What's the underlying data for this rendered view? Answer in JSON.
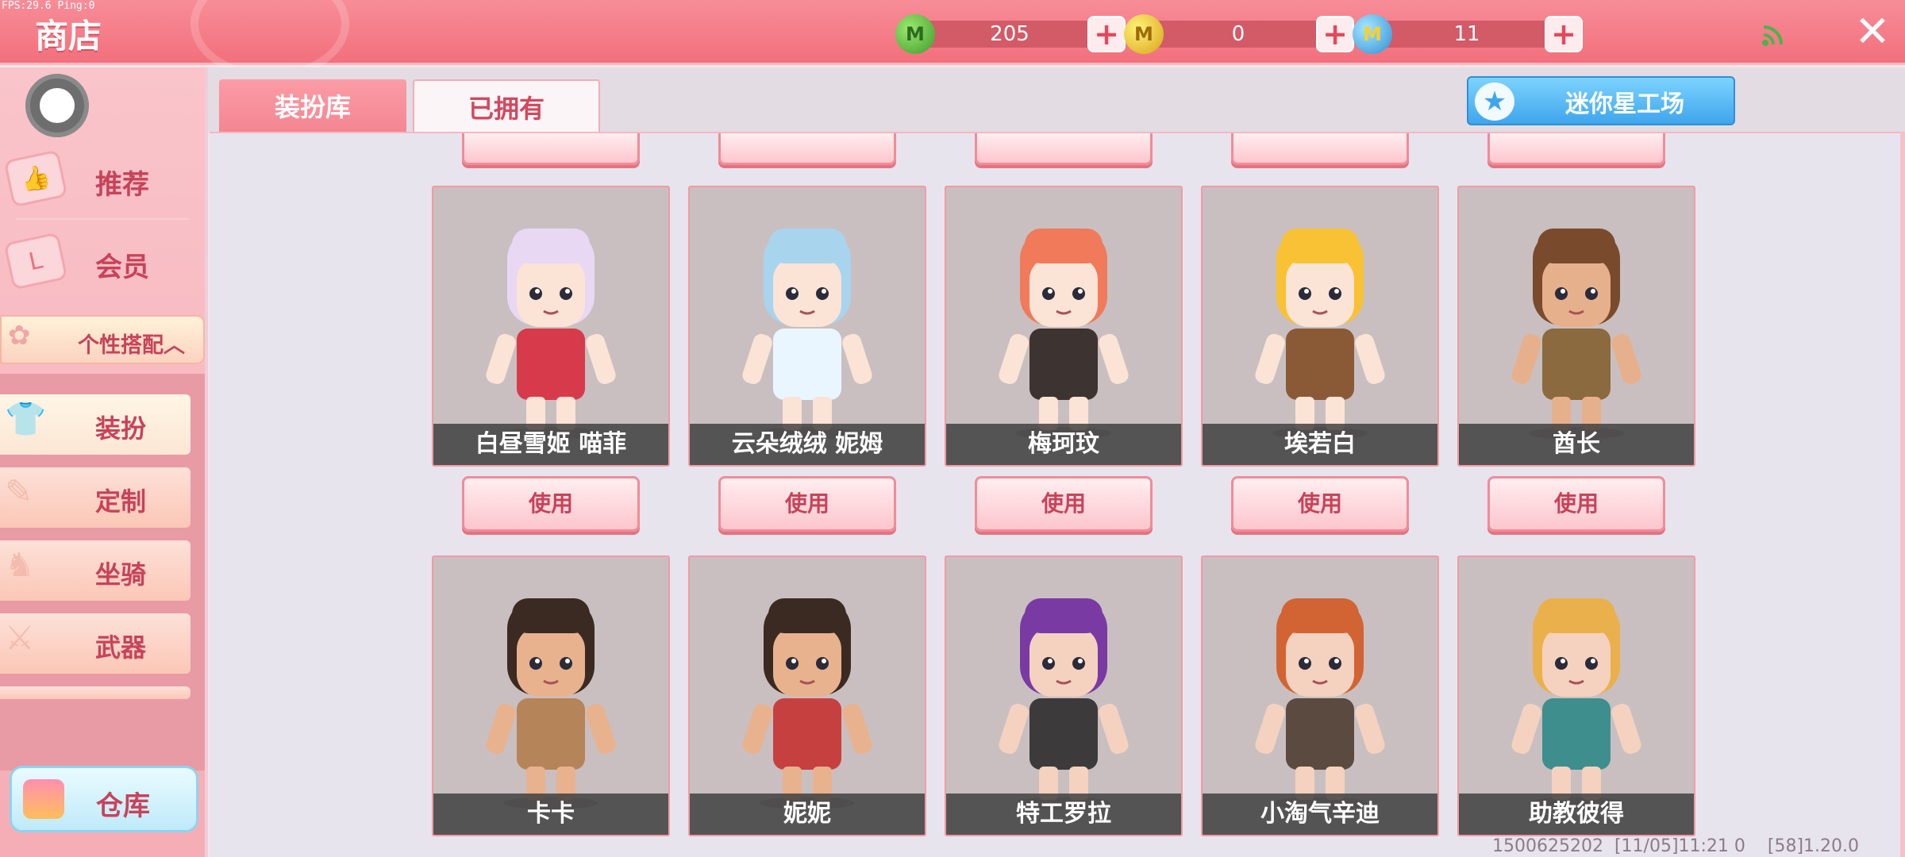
{
  "topbar": {
    "fps": "FPS:29.6  Ping:0",
    "title": "商店",
    "currencies": [
      {
        "name": "green-gem",
        "value": "205",
        "color": "#3f9a2b"
      },
      {
        "name": "gold-coin",
        "value": "0",
        "color": "#d8a317"
      },
      {
        "name": "blue-star-coin",
        "value": "11",
        "color": "#2f8fd6"
      }
    ],
    "signal_icon": "wifi-signal-icon",
    "close_icon": "close-icon"
  },
  "sidebar": {
    "main_items": [
      {
        "label": "推荐",
        "icon": "thumbs-up-icon"
      },
      {
        "label": "会员",
        "icon": "vip-card-icon"
      }
    ],
    "group": {
      "label": "个性搭配︿",
      "icon": "flower-icon"
    },
    "sub_items": [
      {
        "label": "装扮",
        "icon": "shirt-icon",
        "active": true
      },
      {
        "label": "定制",
        "icon": "pencil-icon",
        "active": false
      },
      {
        "label": "坐骑",
        "icon": "mount-icon",
        "active": false
      },
      {
        "label": "武器",
        "icon": "gun-icon",
        "active": false
      }
    ],
    "warehouse": {
      "label": "仓库",
      "icon": "box-icon"
    }
  },
  "tabs": [
    {
      "label": "装扮库",
      "active": false
    },
    {
      "label": "已拥有",
      "active": true
    }
  ],
  "workshop_button": {
    "label": "迷你星工场",
    "icon": "star-icon"
  },
  "use_label": "使用",
  "characters_row1": [
    {
      "name": "白昼雪姬 喵菲",
      "hair": "#e8d8f4",
      "outfit": "#d73a4a",
      "skin": "#fbe3d6"
    },
    {
      "name": "云朵绒绒 妮姆",
      "hair": "#a9d4ee",
      "outfit": "#eaf6ff",
      "skin": "#fbe3d6"
    },
    {
      "name": "梅珂玟",
      "hair": "#f07a5a",
      "outfit": "#3d3330",
      "skin": "#fbe3d6"
    },
    {
      "name": "埃若白",
      "hair": "#f8c234",
      "outfit": "#8a5a36",
      "skin": "#fbe3d6"
    },
    {
      "name": "酋长",
      "hair": "#7a4a2c",
      "outfit": "#8a6a3e",
      "skin": "#e7b08d"
    }
  ],
  "characters_row2": [
    {
      "name": "卡卡",
      "hair": "#3a2a22",
      "outfit": "#b58458",
      "skin": "#e8b28e"
    },
    {
      "name": "妮妮",
      "hair": "#3a2a22",
      "outfit": "#c64040",
      "skin": "#e8b28e"
    },
    {
      "name": "特工罗拉",
      "hair": "#7a3aa4",
      "outfit": "#3d3a3c",
      "skin": "#f4d2bf"
    },
    {
      "name": "小淘气辛迪",
      "hair": "#d26434",
      "outfit": "#5a4a40",
      "skin": "#f4d2bf"
    },
    {
      "name": "助教彼得",
      "hair": "#eab04c",
      "outfit": "#3e8e8e",
      "skin": "#f4d2bf"
    }
  ],
  "footer": "1500625202  [11/05]11:21 0    [58]1.20.0"
}
